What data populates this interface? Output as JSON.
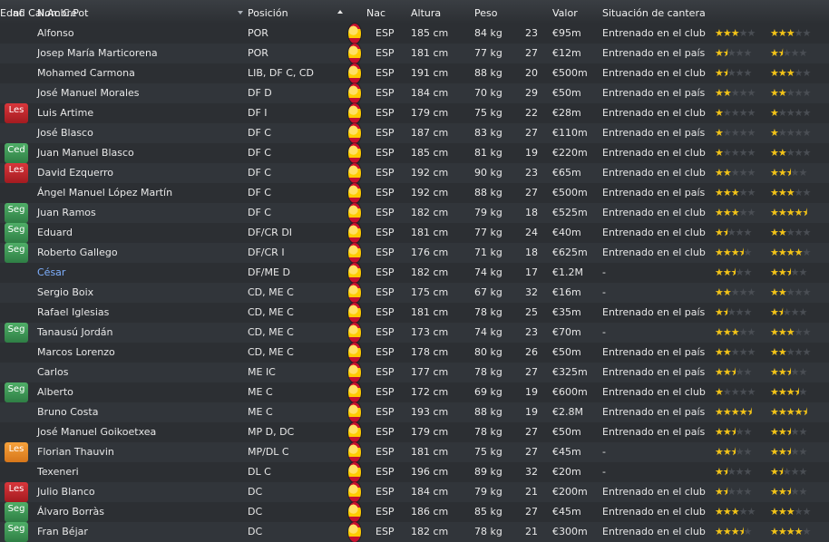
{
  "columns": {
    "inf": "Inf",
    "nombre": "Nombre",
    "posicion": "Posición",
    "nac": "Nac",
    "altura": "Altura",
    "peso": "Peso",
    "edad": "Edad",
    "valor": "Valor",
    "situacion": "Situación de cantera",
    "cal": "Cal.Ac",
    "pot": "C.Pot"
  },
  "players": [
    {
      "inf": "",
      "name": "Alfonso",
      "pos": "POR",
      "nac": "ESP",
      "alt": "185 cm",
      "peso": "84 kg",
      "edad": "23",
      "valor": "€95m",
      "sit": "Entrenado en el club",
      "cal": 3,
      "pot": 3
    },
    {
      "inf": "",
      "name": "Josep María Marticorena",
      "pos": "POR",
      "nac": "ESP",
      "alt": "181 cm",
      "peso": "77 kg",
      "edad": "27",
      "valor": "€12m",
      "sit": "Entrenado en el país",
      "cal": 1.5,
      "pot": 1.5
    },
    {
      "inf": "",
      "name": "Mohamed Carmona",
      "pos": "LIB, DF C, CD",
      "nac": "ESP",
      "alt": "191 cm",
      "peso": "88 kg",
      "edad": "20",
      "valor": "€500m",
      "sit": "Entrenado en el club",
      "cal": 1.5,
      "pot": 3
    },
    {
      "inf": "",
      "name": "José Manuel Morales",
      "pos": "DF D",
      "nac": "ESP",
      "alt": "184 cm",
      "peso": "70 kg",
      "edad": "29",
      "valor": "€50m",
      "sit": "Entrenado en el país",
      "cal": 2,
      "pot": 2
    },
    {
      "inf": "Les",
      "infType": "les",
      "name": "Luis Artime",
      "pos": "DF I",
      "nac": "ESP",
      "alt": "179 cm",
      "peso": "75 kg",
      "edad": "22",
      "valor": "€28m",
      "sit": "Entrenado en el club",
      "cal": 1,
      "pot": 1
    },
    {
      "inf": "",
      "name": "José Blasco",
      "pos": "DF C",
      "nac": "ESP",
      "alt": "187 cm",
      "peso": "83 kg",
      "edad": "27",
      "valor": "€110m",
      "sit": "Entrenado en el país",
      "cal": 1,
      "pot": 1
    },
    {
      "inf": "Ced",
      "infType": "ced",
      "name": "Juan Manuel Blasco",
      "pos": "DF C",
      "nac": "ESP",
      "alt": "185 cm",
      "peso": "81 kg",
      "edad": "19",
      "valor": "€220m",
      "sit": "Entrenado en el club",
      "cal": 1,
      "pot": 2
    },
    {
      "inf": "Les",
      "infType": "les",
      "name": "David Ezquerro",
      "pos": "DF C",
      "nac": "ESP",
      "alt": "192 cm",
      "peso": "90 kg",
      "edad": "23",
      "valor": "€65m",
      "sit": "Entrenado en el club",
      "cal": 2,
      "pot": 2.5
    },
    {
      "inf": "",
      "name": "Ángel Manuel López Martín",
      "pos": "DF C",
      "nac": "ESP",
      "alt": "192 cm",
      "peso": "88 kg",
      "edad": "27",
      "valor": "€500m",
      "sit": "Entrenado en el país",
      "cal": 3,
      "pot": 3
    },
    {
      "inf": "Seg",
      "infType": "seg",
      "name": "Juan Ramos",
      "pos": "DF C",
      "nac": "ESP",
      "alt": "182 cm",
      "peso": "79 kg",
      "edad": "18",
      "valor": "€525m",
      "sit": "Entrenado en el club",
      "cal": 3,
      "pot": 4.5
    },
    {
      "inf": "Seg",
      "infType": "seg",
      "name": "Eduard",
      "pos": "DF/CR DI",
      "nac": "ESP",
      "alt": "181 cm",
      "peso": "77 kg",
      "edad": "24",
      "valor": "€40m",
      "sit": "Entrenado en el club",
      "cal": 1.5,
      "pot": 2
    },
    {
      "inf": "Seg",
      "infType": "seg",
      "name": "Roberto Gallego",
      "pos": "DF/CR I",
      "nac": "ESP",
      "alt": "176 cm",
      "peso": "71 kg",
      "edad": "18",
      "valor": "€625m",
      "sit": "Entrenado en el club",
      "cal": 3.5,
      "pot": 4
    },
    {
      "inf": "",
      "name": "César",
      "link": true,
      "pos": "DF/ME D",
      "nac": "ESP",
      "alt": "182 cm",
      "peso": "74 kg",
      "edad": "17",
      "valor": "€1.2M",
      "sit": "-",
      "cal": 2.5,
      "pot": 2.5
    },
    {
      "inf": "",
      "name": "Sergio Boix",
      "pos": "CD, ME C",
      "nac": "ESP",
      "alt": "175 cm",
      "peso": "67 kg",
      "edad": "32",
      "valor": "€16m",
      "sit": "-",
      "cal": 2,
      "pot": 2
    },
    {
      "inf": "",
      "name": "Rafael Iglesias",
      "pos": "CD, ME C",
      "nac": "ESP",
      "alt": "181 cm",
      "peso": "78 kg",
      "edad": "25",
      "valor": "€35m",
      "sit": "Entrenado en el país",
      "cal": 1.5,
      "pot": 1.5
    },
    {
      "inf": "Seg",
      "infType": "seg",
      "name": "Tanausú Jordán",
      "pos": "CD, ME C",
      "nac": "ESP",
      "alt": "173 cm",
      "peso": "74 kg",
      "edad": "23",
      "valor": "€70m",
      "sit": "-",
      "cal": 3,
      "pot": 3
    },
    {
      "inf": "",
      "name": "Marcos Lorenzo",
      "pos": "CD, ME C",
      "nac": "ESP",
      "alt": "178 cm",
      "peso": "80 kg",
      "edad": "26",
      "valor": "€50m",
      "sit": "Entrenado en el país",
      "cal": 2,
      "pot": 2
    },
    {
      "inf": "",
      "name": "Carlos",
      "pos": "ME IC",
      "nac": "ESP",
      "alt": "177 cm",
      "peso": "78 kg",
      "edad": "27",
      "valor": "€325m",
      "sit": "Entrenado en el país",
      "cal": 2.5,
      "pot": 2.5
    },
    {
      "inf": "Seg",
      "infType": "seg",
      "name": "Alberto",
      "pos": "ME C",
      "nac": "ESP",
      "alt": "172 cm",
      "peso": "69 kg",
      "edad": "19",
      "valor": "€600m",
      "sit": "Entrenado en el club",
      "cal": 1,
      "pot": 3.5
    },
    {
      "inf": "",
      "name": "Bruno Costa",
      "pos": "ME C",
      "nac": "ESP",
      "alt": "193 cm",
      "peso": "88 kg",
      "edad": "19",
      "valor": "€2.8M",
      "sit": "Entrenado en el país",
      "cal": 4.5,
      "pot": 4.5
    },
    {
      "inf": "",
      "name": "José Manuel Goikoetxea",
      "pos": "MP D, DC",
      "nac": "ESP",
      "alt": "179 cm",
      "peso": "78 kg",
      "edad": "27",
      "valor": "€50m",
      "sit": "Entrenado en el país",
      "cal": 2.5,
      "pot": 2.5
    },
    {
      "inf": "Les",
      "infType": "les-orange",
      "name": "Florian Thauvin",
      "pos": "MP/DL C",
      "nac": "ESP",
      "alt": "181 cm",
      "peso": "75 kg",
      "edad": "27",
      "valor": "€45m",
      "sit": "-",
      "cal": 2.5,
      "pot": 2.5
    },
    {
      "inf": "",
      "name": "Texeneri",
      "pos": "DL C",
      "nac": "ESP",
      "alt": "196 cm",
      "peso": "89 kg",
      "edad": "32",
      "valor": "€20m",
      "sit": "-",
      "cal": 1.5,
      "pot": 1.5
    },
    {
      "inf": "Les",
      "infType": "les",
      "name": "Julio Blanco",
      "pos": "DC",
      "nac": "ESP",
      "alt": "184 cm",
      "peso": "79 kg",
      "edad": "21",
      "valor": "€200m",
      "sit": "Entrenado en el club",
      "cal": 1.5,
      "pot": 2.5
    },
    {
      "inf": "Seg",
      "infType": "seg",
      "name": "Álvaro Borràs",
      "pos": "DC",
      "nac": "ESP",
      "alt": "186 cm",
      "peso": "85 kg",
      "edad": "27",
      "valor": "€45m",
      "sit": "Entrenado en el club",
      "cal": 3,
      "pot": 3
    },
    {
      "inf": "Seg",
      "infType": "seg",
      "name": "Fran Béjar",
      "pos": "DC",
      "nac": "ESP",
      "alt": "182 cm",
      "peso": "78 kg",
      "edad": "21",
      "valor": "€300m",
      "sit": "Entrenado en el club",
      "cal": 3.5,
      "pot": 4
    }
  ]
}
